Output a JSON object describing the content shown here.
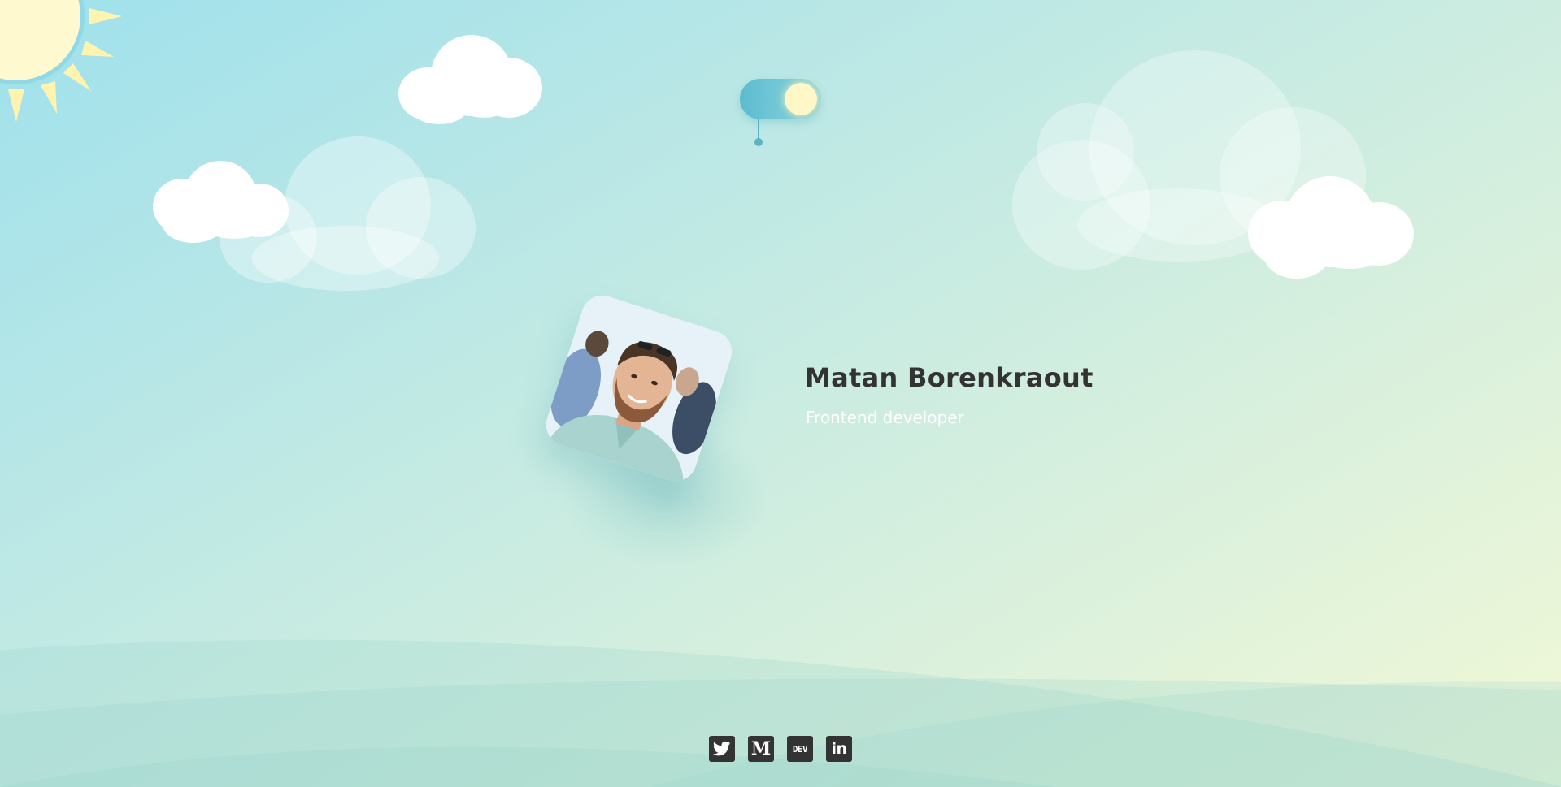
{
  "profile": {
    "name": "Matan Borenkraout",
    "role": "Frontend developer"
  },
  "theme_toggle": {
    "state": "light"
  },
  "social": [
    {
      "label": "M",
      "icon": "medium-icon"
    },
    {
      "label": "DEV",
      "icon": "dev-icon"
    },
    {
      "label": "in",
      "icon": "linkedin-icon"
    }
  ],
  "colors": {
    "sky_top": "#9fe1ec",
    "sky_bottom": "#f2f8d6",
    "sun": "#fff7c7",
    "toggle": "#5bbccf",
    "text_dark": "#333333",
    "icon_bg": "#333333"
  }
}
